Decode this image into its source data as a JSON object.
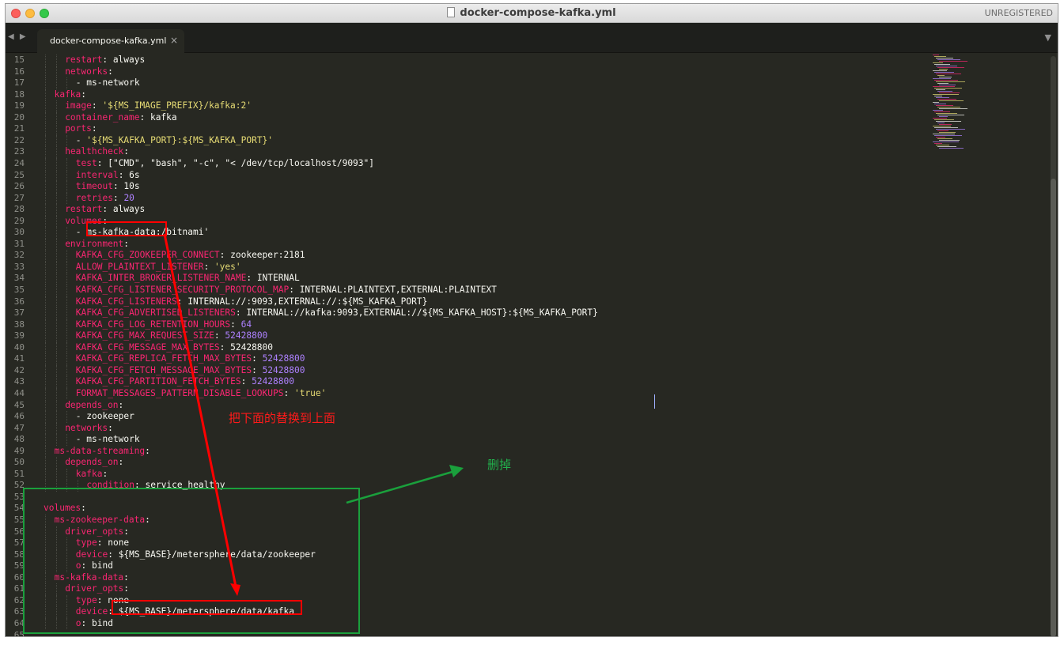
{
  "window": {
    "title": "docker-compose-kafka.yml",
    "unregistered": "UNREGISTERED"
  },
  "tabs": [
    {
      "label": "docker-compose-kafka.yml",
      "close": "×"
    }
  ],
  "nav": {
    "arrows": "◀ ▶",
    "menu": "▼"
  },
  "code_lines": [
    {
      "n": "15",
      "i": 2,
      "parts": [
        [
          "k",
          "restart"
        ],
        [
          "p",
          ": always"
        ]
      ]
    },
    {
      "n": "16",
      "i": 2,
      "parts": [
        [
          "k",
          "networks"
        ],
        [
          "p",
          ":"
        ]
      ]
    },
    {
      "n": "17",
      "i": 3,
      "parts": [
        [
          "p",
          "- ms-network"
        ]
      ]
    },
    {
      "n": "18",
      "i": 1,
      "parts": [
        [
          "k",
          "kafka"
        ],
        [
          "p",
          ":"
        ]
      ]
    },
    {
      "n": "19",
      "i": 2,
      "parts": [
        [
          "k",
          "image"
        ],
        [
          "p",
          ": "
        ],
        [
          "s",
          "'${MS_IMAGE_PREFIX}/kafka:2'"
        ]
      ]
    },
    {
      "n": "20",
      "i": 2,
      "parts": [
        [
          "k",
          "container_name"
        ],
        [
          "p",
          ": kafka"
        ]
      ]
    },
    {
      "n": "21",
      "i": 2,
      "parts": [
        [
          "k",
          "ports"
        ],
        [
          "p",
          ":"
        ]
      ]
    },
    {
      "n": "22",
      "i": 3,
      "parts": [
        [
          "p",
          "- "
        ],
        [
          "s",
          "'${MS_KAFKA_PORT}:${MS_KAFKA_PORT}'"
        ]
      ]
    },
    {
      "n": "23",
      "i": 2,
      "parts": [
        [
          "k",
          "healthcheck"
        ],
        [
          "p",
          ":"
        ]
      ]
    },
    {
      "n": "24",
      "i": 3,
      "parts": [
        [
          "k",
          "test"
        ],
        [
          "p",
          ": [\"CMD\", \"bash\", \"-c\", \"< /dev/tcp/localhost/9093\"]"
        ]
      ]
    },
    {
      "n": "25",
      "i": 3,
      "parts": [
        [
          "k",
          "interval"
        ],
        [
          "p",
          ": 6s"
        ]
      ]
    },
    {
      "n": "26",
      "i": 3,
      "parts": [
        [
          "k",
          "timeout"
        ],
        [
          "p",
          ": 10s"
        ]
      ]
    },
    {
      "n": "27",
      "i": 3,
      "parts": [
        [
          "k",
          "retries"
        ],
        [
          "p",
          ": "
        ],
        [
          "n",
          "20"
        ]
      ]
    },
    {
      "n": "28",
      "i": 2,
      "parts": [
        [
          "k",
          "restart"
        ],
        [
          "p",
          ": always"
        ]
      ]
    },
    {
      "n": "29",
      "i": 2,
      "parts": [
        [
          "k",
          "volumes"
        ],
        [
          "p",
          ":"
        ]
      ]
    },
    {
      "n": "30",
      "i": 3,
      "parts": [
        [
          "p",
          "- ms-kafka-data:/bitnami'"
        ]
      ]
    },
    {
      "n": "31",
      "i": 2,
      "parts": [
        [
          "k",
          "environment"
        ],
        [
          "p",
          ":"
        ]
      ]
    },
    {
      "n": "32",
      "i": 3,
      "parts": [
        [
          "k",
          "KAFKA_CFG_ZOOKEEPER_CONNECT"
        ],
        [
          "p",
          ": zookeeper:2181"
        ]
      ]
    },
    {
      "n": "33",
      "i": 3,
      "parts": [
        [
          "k",
          "ALLOW_PLAINTEXT_LISTENER"
        ],
        [
          "p",
          ": "
        ],
        [
          "s",
          "'yes'"
        ]
      ]
    },
    {
      "n": "34",
      "i": 3,
      "parts": [
        [
          "k",
          "KAFKA_INTER_BROKER_LISTENER_NAME"
        ],
        [
          "p",
          ": INTERNAL"
        ]
      ]
    },
    {
      "n": "35",
      "i": 3,
      "parts": [
        [
          "k",
          "KAFKA_CFG_LISTENER_SECURITY_PROTOCOL_MAP"
        ],
        [
          "p",
          ": INTERNAL:PLAINTEXT,EXTERNAL:PLAINTEXT"
        ]
      ]
    },
    {
      "n": "36",
      "i": 3,
      "parts": [
        [
          "k",
          "KAFKA_CFG_LISTENERS"
        ],
        [
          "p",
          ": INTERNAL://:9093,EXTERNAL://:${MS_KAFKA_PORT}"
        ]
      ]
    },
    {
      "n": "37",
      "i": 3,
      "parts": [
        [
          "k",
          "KAFKA_CFG_ADVERTISED_LISTENERS"
        ],
        [
          "p",
          ": INTERNAL://kafka:9093,EXTERNAL://${MS_KAFKA_HOST}:${MS_KAFKA_PORT}"
        ]
      ]
    },
    {
      "n": "38",
      "i": 3,
      "parts": [
        [
          "k",
          "KAFKA_CFG_LOG_RETENTION_HOURS"
        ],
        [
          "p",
          ": "
        ],
        [
          "n",
          "64"
        ]
      ]
    },
    {
      "n": "39",
      "i": 3,
      "parts": [
        [
          "k",
          "KAFKA_CFG_MAX_REQUEST_SIZE"
        ],
        [
          "p",
          ": "
        ],
        [
          "n",
          "52428800"
        ]
      ]
    },
    {
      "n": "40",
      "i": 3,
      "parts": [
        [
          "k",
          "KAFKA_CFG_MESSAGE_MAX_BYTES"
        ],
        [
          "p",
          ": 52428800"
        ]
      ]
    },
    {
      "n": "41",
      "i": 3,
      "parts": [
        [
          "k",
          "KAFKA_CFG_REPLICA_FETCH_MAX_BYTES"
        ],
        [
          "p",
          ": "
        ],
        [
          "n",
          "52428800"
        ]
      ]
    },
    {
      "n": "42",
      "i": 3,
      "parts": [
        [
          "k",
          "KAFKA_CFG_FETCH_MESSAGE_MAX_BYTES"
        ],
        [
          "p",
          ": "
        ],
        [
          "n",
          "52428800"
        ]
      ]
    },
    {
      "n": "43",
      "i": 3,
      "parts": [
        [
          "k",
          "KAFKA_CFG_PARTITION_FETCH_BYTES"
        ],
        [
          "p",
          ": "
        ],
        [
          "n",
          "52428800"
        ]
      ]
    },
    {
      "n": "44",
      "i": 3,
      "parts": [
        [
          "k",
          "FORMAT_MESSAGES_PATTERN_DISABLE_LOOKUPS"
        ],
        [
          "p",
          ": "
        ],
        [
          "s",
          "'true'"
        ]
      ]
    },
    {
      "n": "45",
      "i": 2,
      "parts": [
        [
          "k",
          "depends_on"
        ],
        [
          "p",
          ":"
        ]
      ]
    },
    {
      "n": "46",
      "i": 3,
      "parts": [
        [
          "p",
          "- zookeeper"
        ]
      ]
    },
    {
      "n": "47",
      "i": 2,
      "parts": [
        [
          "k",
          "networks"
        ],
        [
          "p",
          ":"
        ]
      ]
    },
    {
      "n": "48",
      "i": 3,
      "parts": [
        [
          "p",
          "- ms-network"
        ]
      ]
    },
    {
      "n": "49",
      "i": 1,
      "parts": [
        [
          "k",
          "ms-data-streaming"
        ],
        [
          "p",
          ":"
        ]
      ]
    },
    {
      "n": "50",
      "i": 2,
      "parts": [
        [
          "k",
          "depends_on"
        ],
        [
          "p",
          ":"
        ]
      ]
    },
    {
      "n": "51",
      "i": 3,
      "parts": [
        [
          "k",
          "kafka"
        ],
        [
          "p",
          ":"
        ]
      ]
    },
    {
      "n": "52",
      "i": 4,
      "parts": [
        [
          "k",
          "condition"
        ],
        [
          "p",
          ": service_healthy"
        ]
      ]
    },
    {
      "n": "53",
      "i": 0,
      "parts": []
    },
    {
      "n": "54",
      "i": 0,
      "parts": [
        [
          "k",
          "volumes"
        ],
        [
          "p",
          ":"
        ]
      ]
    },
    {
      "n": "55",
      "i": 1,
      "parts": [
        [
          "k",
          "ms-zookeeper-data"
        ],
        [
          "p",
          ":"
        ]
      ]
    },
    {
      "n": "56",
      "i": 2,
      "parts": [
        [
          "k",
          "driver_opts"
        ],
        [
          "p",
          ":"
        ]
      ]
    },
    {
      "n": "57",
      "i": 3,
      "parts": [
        [
          "k",
          "type"
        ],
        [
          "p",
          ": none"
        ]
      ]
    },
    {
      "n": "58",
      "i": 3,
      "parts": [
        [
          "k",
          "device"
        ],
        [
          "p",
          ": ${MS_BASE}/metersphere/data/zookeeper"
        ]
      ]
    },
    {
      "n": "59",
      "i": 3,
      "parts": [
        [
          "k",
          "o"
        ],
        [
          "p",
          ": bind"
        ]
      ]
    },
    {
      "n": "60",
      "i": 1,
      "parts": [
        [
          "k",
          "ms-kafka-data"
        ],
        [
          "p",
          ":"
        ]
      ]
    },
    {
      "n": "61",
      "i": 2,
      "parts": [
        [
          "k",
          "driver_opts"
        ],
        [
          "p",
          ":"
        ]
      ]
    },
    {
      "n": "62",
      "i": 3,
      "parts": [
        [
          "k",
          "type"
        ],
        [
          "p",
          ": none"
        ]
      ]
    },
    {
      "n": "63",
      "i": 3,
      "parts": [
        [
          "k",
          "device"
        ],
        [
          "p",
          ": ${MS_BASE}/metersphere/data/kafka"
        ]
      ]
    },
    {
      "n": "64",
      "i": 3,
      "parts": [
        [
          "k",
          "o"
        ],
        [
          "p",
          ": bind"
        ]
      ]
    },
    {
      "n": "65",
      "i": 0,
      "parts": []
    }
  ],
  "annotations": {
    "replace_note": "把下面的替换到上面",
    "delete_note": "删掉"
  },
  "colors": {
    "background": "#272822",
    "keyword": "#f92672",
    "string": "#e6db74",
    "number": "#ae81ff",
    "plain": "#f8f8f2",
    "annotation_red": "#ff0000",
    "annotation_green": "#1aa03c"
  }
}
